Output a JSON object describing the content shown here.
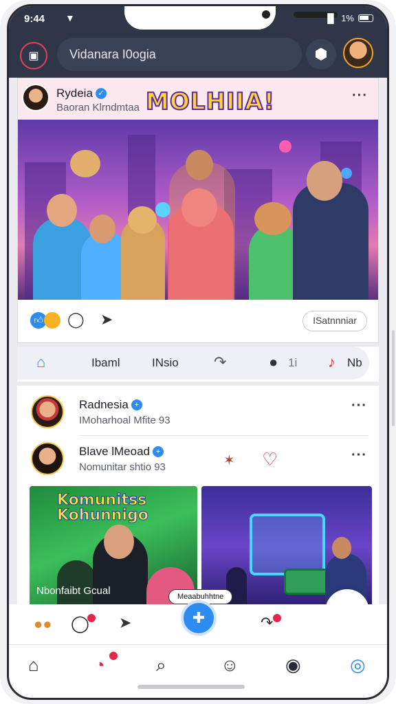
{
  "status": {
    "time": "9:44",
    "battery": "1%"
  },
  "header": {
    "search_text": "Vidanara I0ogia"
  },
  "post1": {
    "author": "Rydeia",
    "subtitle": "Baoran Klrndmtaa",
    "banner_text": "MOLHIIA!",
    "button_label": "ISatnnniar"
  },
  "tabs": [
    {
      "label": "Ibaml"
    },
    {
      "label": "INsio"
    },
    {
      "label": "1i"
    },
    {
      "label": "Nb"
    }
  ],
  "post2": {
    "author": "Radnesia",
    "subtitle": "IMoharhoal Mfite 93"
  },
  "post3": {
    "author": "Blave lMeoad",
    "subtitle": "Nomunitar shtio 93",
    "thumb1_title_line1": "Komunitss",
    "thumb1_title_line2": "Kohunnigo",
    "thumb1_caption": "Nbonfaibt Gcual",
    "chip_label": "Meaabuhhtne"
  },
  "colors": {
    "appbar": "#2f3647",
    "accent": "#2d8cf0",
    "badge": "#e0294a"
  },
  "icons": [
    "calendar-icon",
    "settings-icon",
    "like-icon",
    "comment-icon",
    "send-icon",
    "home-icon",
    "share-icon",
    "chat-icon",
    "music-icon",
    "search-icon",
    "face-icon",
    "profile-icon",
    "user-icon"
  ]
}
